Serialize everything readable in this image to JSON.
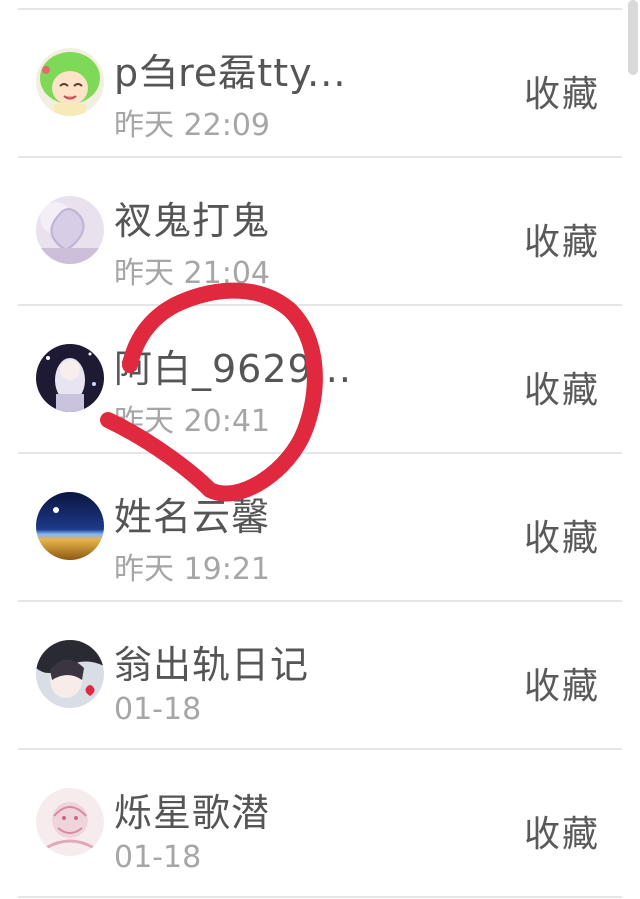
{
  "rows": [
    {
      "name": "p刍re磊tty...",
      "time": "昨天 22:09",
      "action": "收藏",
      "avatar": "green-hair-anime-avatar"
    },
    {
      "name": "衩鬼打鬼",
      "time": "昨天 21:04",
      "action": "收藏",
      "avatar": "lavender-heart-avatar"
    },
    {
      "name": "阿白_9629...",
      "time": "昨天 20:41",
      "action": "收藏",
      "avatar": "dark-anime-avatar"
    },
    {
      "name": "姓名云馨",
      "time": "昨天 19:21",
      "action": "收藏",
      "avatar": "night-horizon-avatar"
    },
    {
      "name": "翁出轨日记",
      "time": "01-18",
      "action": "收藏",
      "avatar": "anime-girl-heart-avatar"
    },
    {
      "name": "烁星歌潜",
      "time": "01-18",
      "action": "收藏",
      "avatar": "pink-sketch-avatar"
    }
  ],
  "colors": {
    "name": "#555555",
    "time": "#a6a6a6",
    "action": "#5a5a5a",
    "divider": "#e6e6e6",
    "annotation": "#e0283e"
  }
}
